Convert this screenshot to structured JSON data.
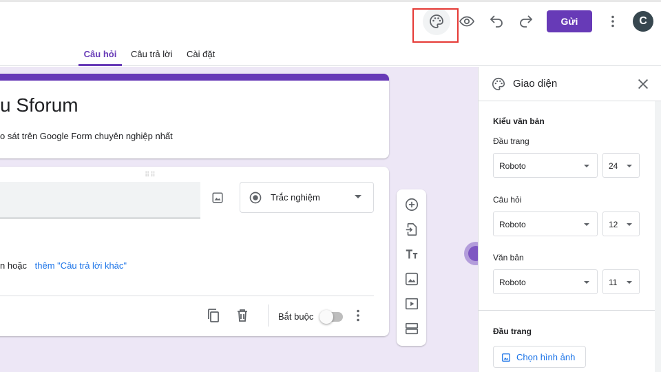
{
  "toolbar": {
    "send_label": "Gửi",
    "avatar_initial": "C"
  },
  "tabs": [
    {
      "label": "Câu hỏi",
      "active": true
    },
    {
      "label": "Câu trả lời"
    },
    {
      "label": "Cài đặt"
    }
  ],
  "form": {
    "title": "u Sforum",
    "description": "o sát trên Google Form chuyên nghiệp nhất"
  },
  "question": {
    "type_label": "Trắc nghiệm",
    "or_text": "n  hoặc",
    "add_other_label": "thêm \"Câu trả lời khác\"",
    "required_label": "Bắt buộc",
    "required_on": false
  },
  "theme_panel": {
    "title": "Giao diện",
    "text_style_title": "Kiểu văn bản",
    "header_label": "Đầu trang",
    "header_font": "Roboto",
    "header_size": "24",
    "question_label": "Câu hỏi",
    "question_font": "Roboto",
    "question_size": "12",
    "text_label": "Văn bản",
    "text_font": "Roboto",
    "text_size": "11",
    "header_section_title": "Đầu trang",
    "choose_image_label": "Chọn hình ảnh"
  },
  "colors": {
    "accent": "#673ab7",
    "background": "#ede7f6",
    "link": "#1a73e8",
    "highlight": "#e53935"
  }
}
